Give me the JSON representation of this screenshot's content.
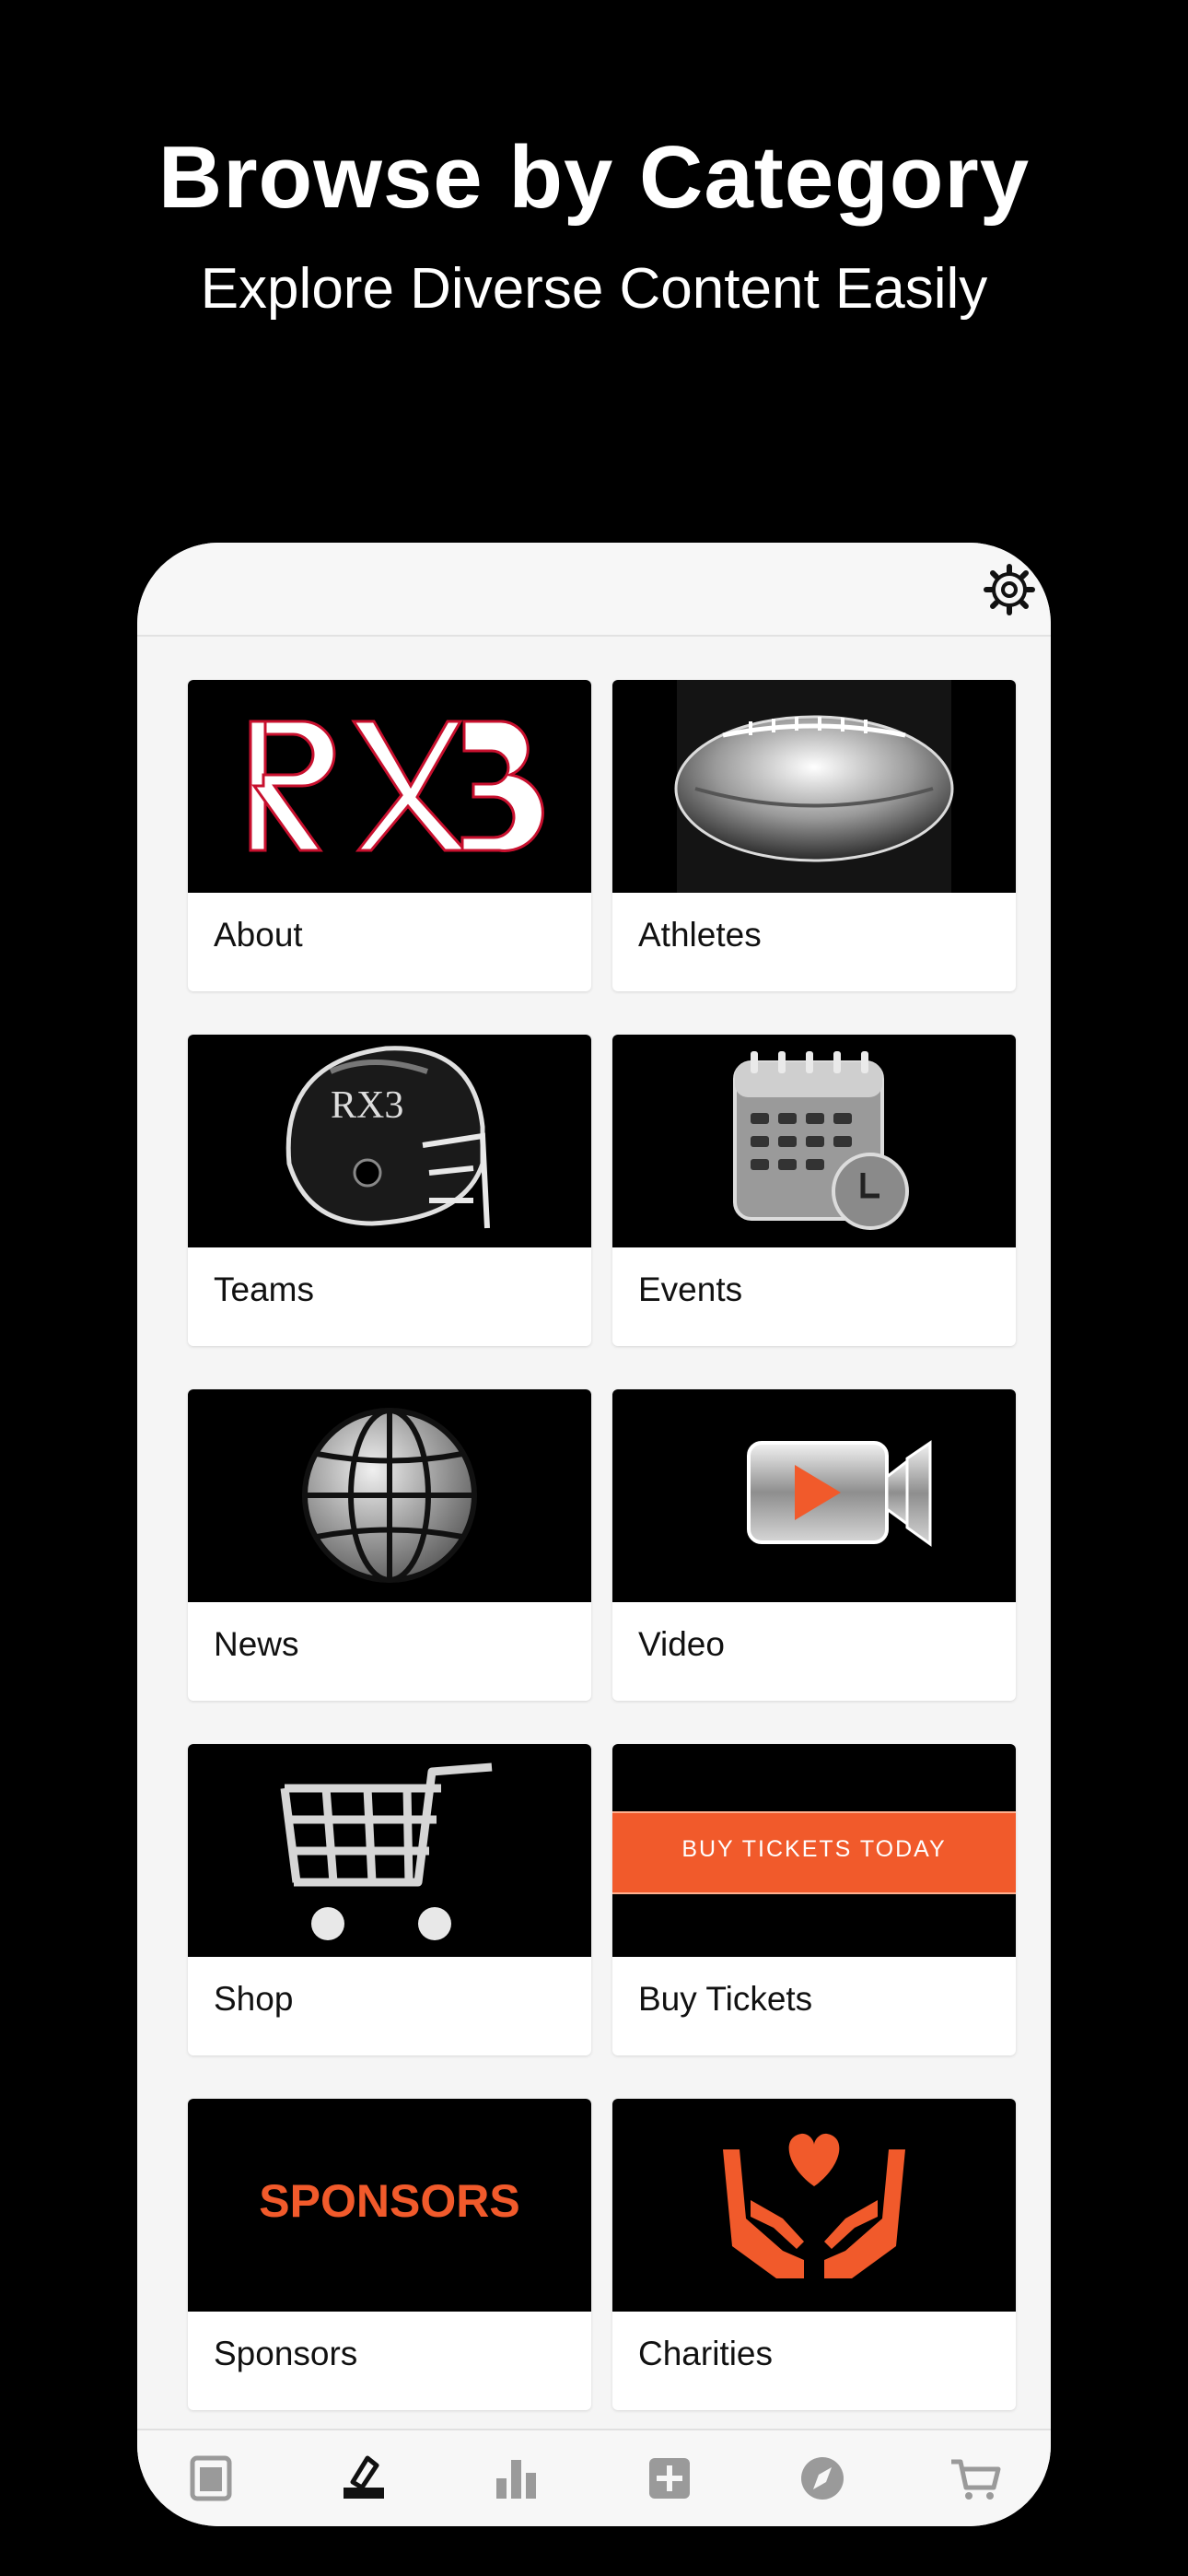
{
  "hero": {
    "title": "Browse by Category",
    "subtitle": "Explore Diverse Content Easily"
  },
  "app": {
    "settings_icon": "gear-icon",
    "categories": [
      {
        "label": "About",
        "image": "rx3-logo"
      },
      {
        "label": "Athletes",
        "image": "football-icon"
      },
      {
        "label": "Teams",
        "image": "helmet-icon"
      },
      {
        "label": "Events",
        "image": "calendar-icon"
      },
      {
        "label": "News",
        "image": "globe-icon"
      },
      {
        "label": "Video",
        "image": "video-camera-icon"
      },
      {
        "label": "Shop",
        "image": "cart-icon"
      },
      {
        "label": "Buy Tickets",
        "image": "buy-tickets-banner",
        "banner_text": "BUY TICKETS TODAY"
      },
      {
        "label": "Sponsors",
        "image": "sponsors-wordmark",
        "banner_text": "SPONSORS"
      },
      {
        "label": "Charities",
        "image": "charity-hands-icon"
      }
    ],
    "tabs": [
      {
        "icon": "news-icon",
        "active": false
      },
      {
        "icon": "ballot-icon",
        "active": true
      },
      {
        "icon": "stats-icon",
        "active": false
      },
      {
        "icon": "add-icon",
        "active": false
      },
      {
        "icon": "compass-icon",
        "active": false
      },
      {
        "icon": "cart-icon",
        "active": false
      }
    ],
    "colors": {
      "accent": "#f15a2b",
      "background": "#000000",
      "surface": "#f5f5f5",
      "inactive_tab": "#9a9a9a",
      "active_tab": "#111111"
    }
  }
}
